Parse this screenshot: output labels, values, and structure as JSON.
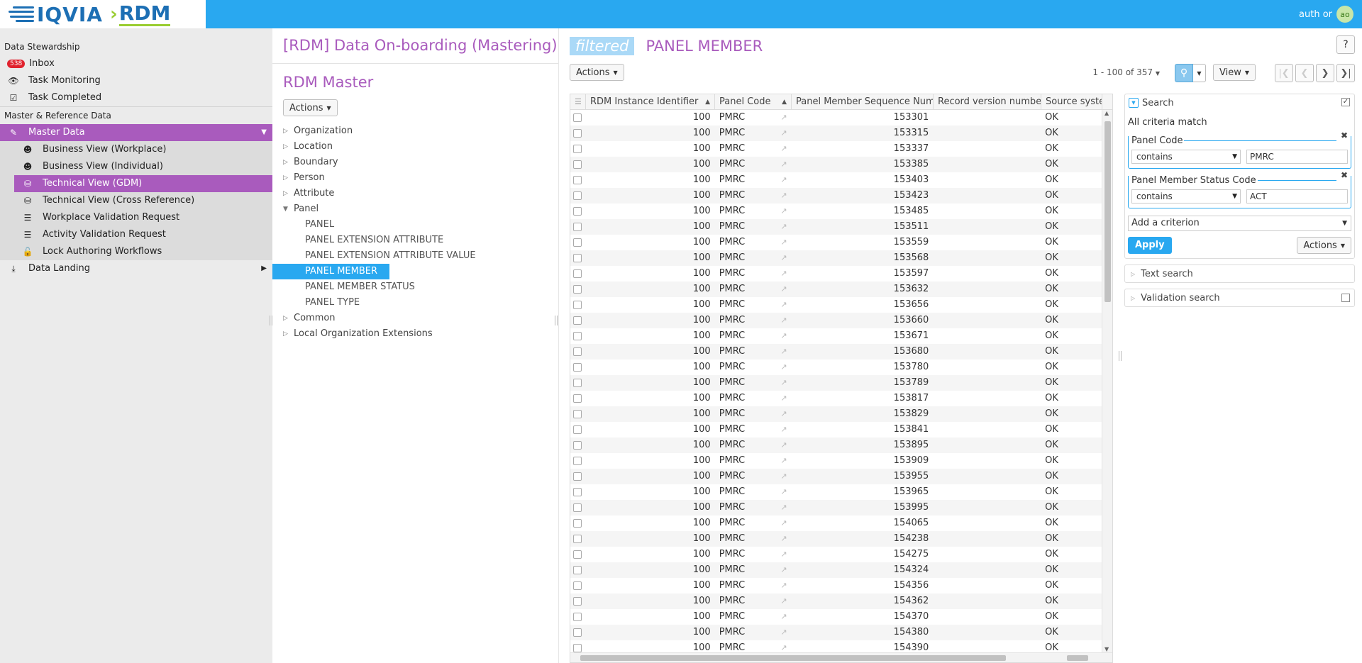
{
  "header": {
    "logo_text": "IQVIA",
    "logo_product": "RDM",
    "user_name": "auth or",
    "avatar_initials": "ao"
  },
  "sidebar": {
    "section_stewardship": "Data Stewardship",
    "inbox_label": "Inbox",
    "inbox_count": "538",
    "task_monitoring": "Task Monitoring",
    "task_completed": "Task Completed",
    "section_master": "Master & Reference Data",
    "master_data": "Master Data",
    "business_view_workplace": "Business View (Workplace)",
    "business_view_individual": "Business View (Individual)",
    "technical_view_gdm": "Technical View (GDM)",
    "technical_view_xref": "Technical View (Cross Reference)",
    "workplace_validation": "Workplace Validation Request",
    "activity_validation": "Activity Validation Request",
    "lock_authoring": "Lock Authoring Workflows",
    "data_landing": "Data Landing"
  },
  "tree_panel": {
    "title": "[RDM] Data On-boarding (Mastering)",
    "subtitle": "RDM Master",
    "actions_label": "Actions",
    "nodes": {
      "organization": "Organization",
      "location": "Location",
      "boundary": "Boundary",
      "person": "Person",
      "attribute": "Attribute",
      "panel": "Panel",
      "panel_leaf": "PANEL",
      "panel_ext_attr": "PANEL EXTENSION ATTRIBUTE",
      "panel_ext_attr_value": "PANEL EXTENSION ATTRIBUTE VALUE",
      "panel_member": "PANEL MEMBER",
      "panel_member_status": "PANEL MEMBER STATUS",
      "panel_type": "PANEL TYPE",
      "common": "Common",
      "local_org_ext": "Local Organization Extensions"
    }
  },
  "main": {
    "filtered_tag": "filtered",
    "title": "PANEL MEMBER",
    "help_label": "?",
    "actions_label": "Actions",
    "pager_text": "1 - 100 of 357",
    "view_label": "View",
    "columns": {
      "rdm_instance": "RDM Instance Identifier",
      "panel_code": "Panel Code",
      "seq_number": "Panel Member Sequence Number",
      "record_version": "Record version number",
      "source_system": "Source system"
    },
    "rows": [
      {
        "inst": "100",
        "code": "PMRC",
        "seq": "153301",
        "src": "OK"
      },
      {
        "inst": "100",
        "code": "PMRC",
        "seq": "153315",
        "src": "OK"
      },
      {
        "inst": "100",
        "code": "PMRC",
        "seq": "153337",
        "src": "OK"
      },
      {
        "inst": "100",
        "code": "PMRC",
        "seq": "153385",
        "src": "OK"
      },
      {
        "inst": "100",
        "code": "PMRC",
        "seq": "153403",
        "src": "OK"
      },
      {
        "inst": "100",
        "code": "PMRC",
        "seq": "153423",
        "src": "OK"
      },
      {
        "inst": "100",
        "code": "PMRC",
        "seq": "153485",
        "src": "OK"
      },
      {
        "inst": "100",
        "code": "PMRC",
        "seq": "153511",
        "src": "OK"
      },
      {
        "inst": "100",
        "code": "PMRC",
        "seq": "153559",
        "src": "OK"
      },
      {
        "inst": "100",
        "code": "PMRC",
        "seq": "153568",
        "src": "OK"
      },
      {
        "inst": "100",
        "code": "PMRC",
        "seq": "153597",
        "src": "OK"
      },
      {
        "inst": "100",
        "code": "PMRC",
        "seq": "153632",
        "src": "OK"
      },
      {
        "inst": "100",
        "code": "PMRC",
        "seq": "153656",
        "src": "OK"
      },
      {
        "inst": "100",
        "code": "PMRC",
        "seq": "153660",
        "src": "OK"
      },
      {
        "inst": "100",
        "code": "PMRC",
        "seq": "153671",
        "src": "OK"
      },
      {
        "inst": "100",
        "code": "PMRC",
        "seq": "153680",
        "src": "OK"
      },
      {
        "inst": "100",
        "code": "PMRC",
        "seq": "153780",
        "src": "OK"
      },
      {
        "inst": "100",
        "code": "PMRC",
        "seq": "153789",
        "src": "OK"
      },
      {
        "inst": "100",
        "code": "PMRC",
        "seq": "153817",
        "src": "OK"
      },
      {
        "inst": "100",
        "code": "PMRC",
        "seq": "153829",
        "src": "OK"
      },
      {
        "inst": "100",
        "code": "PMRC",
        "seq": "153841",
        "src": "OK"
      },
      {
        "inst": "100",
        "code": "PMRC",
        "seq": "153895",
        "src": "OK"
      },
      {
        "inst": "100",
        "code": "PMRC",
        "seq": "153909",
        "src": "OK"
      },
      {
        "inst": "100",
        "code": "PMRC",
        "seq": "153955",
        "src": "OK"
      },
      {
        "inst": "100",
        "code": "PMRC",
        "seq": "153965",
        "src": "OK"
      },
      {
        "inst": "100",
        "code": "PMRC",
        "seq": "153995",
        "src": "OK"
      },
      {
        "inst": "100",
        "code": "PMRC",
        "seq": "154065",
        "src": "OK"
      },
      {
        "inst": "100",
        "code": "PMRC",
        "seq": "154238",
        "src": "OK"
      },
      {
        "inst": "100",
        "code": "PMRC",
        "seq": "154275",
        "src": "OK"
      },
      {
        "inst": "100",
        "code": "PMRC",
        "seq": "154324",
        "src": "OK"
      },
      {
        "inst": "100",
        "code": "PMRC",
        "seq": "154356",
        "src": "OK"
      },
      {
        "inst": "100",
        "code": "PMRC",
        "seq": "154362",
        "src": "OK"
      },
      {
        "inst": "100",
        "code": "PMRC",
        "seq": "154370",
        "src": "OK"
      },
      {
        "inst": "100",
        "code": "PMRC",
        "seq": "154380",
        "src": "OK"
      },
      {
        "inst": "100",
        "code": "PMRC",
        "seq": "154390",
        "src": "OK"
      }
    ]
  },
  "search": {
    "title": "Search",
    "match_text": "All criteria match",
    "criterion1": {
      "label": "Panel Code",
      "operator": "contains",
      "value": "PMRC"
    },
    "criterion2": {
      "label": "Panel Member Status Code",
      "operator": "contains",
      "value": "ACT"
    },
    "add_criterion": "Add a criterion",
    "apply_label": "Apply",
    "actions_label": "Actions",
    "text_search": "Text search",
    "validation_search": "Validation search"
  },
  "colors": {
    "topbar": "#29a8f0",
    "accent_purple": "#a95bbd",
    "selection_blue": "#29a8f0",
    "badge_red": "#e0222e"
  }
}
